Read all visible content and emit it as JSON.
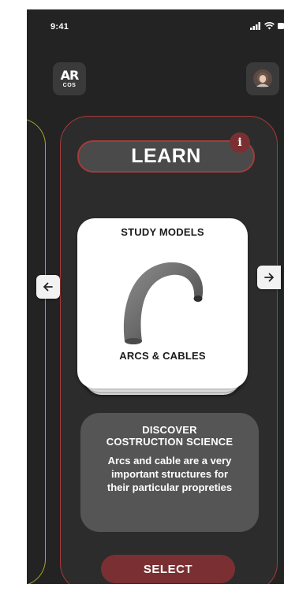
{
  "status_bar": {
    "time": "9:41"
  },
  "header": {
    "logo_main": "AR",
    "logo_sub": "COS"
  },
  "card": {
    "heading": "LEARN",
    "info_label": "i",
    "model_card": {
      "title": "STUDY MODELS",
      "name": "ARCS & CABLES"
    },
    "description": {
      "title_line1": "DISCOVER",
      "title_line2": "COSTRUCTION SCIENCE",
      "body": "Arcs and cable are a very important structures for their particular propreties"
    },
    "select_label": "SELECT"
  },
  "icons": {
    "prev": "arrow-left-icon",
    "next": "arrow-right-icon",
    "info": "info-icon",
    "avatar": "user-avatar-icon"
  },
  "colors": {
    "background": "#232323",
    "card": "#2c2c2c",
    "accent_red": "#7a3032",
    "border_red": "#a53a3a",
    "side_card_border": "#a9a72a"
  }
}
